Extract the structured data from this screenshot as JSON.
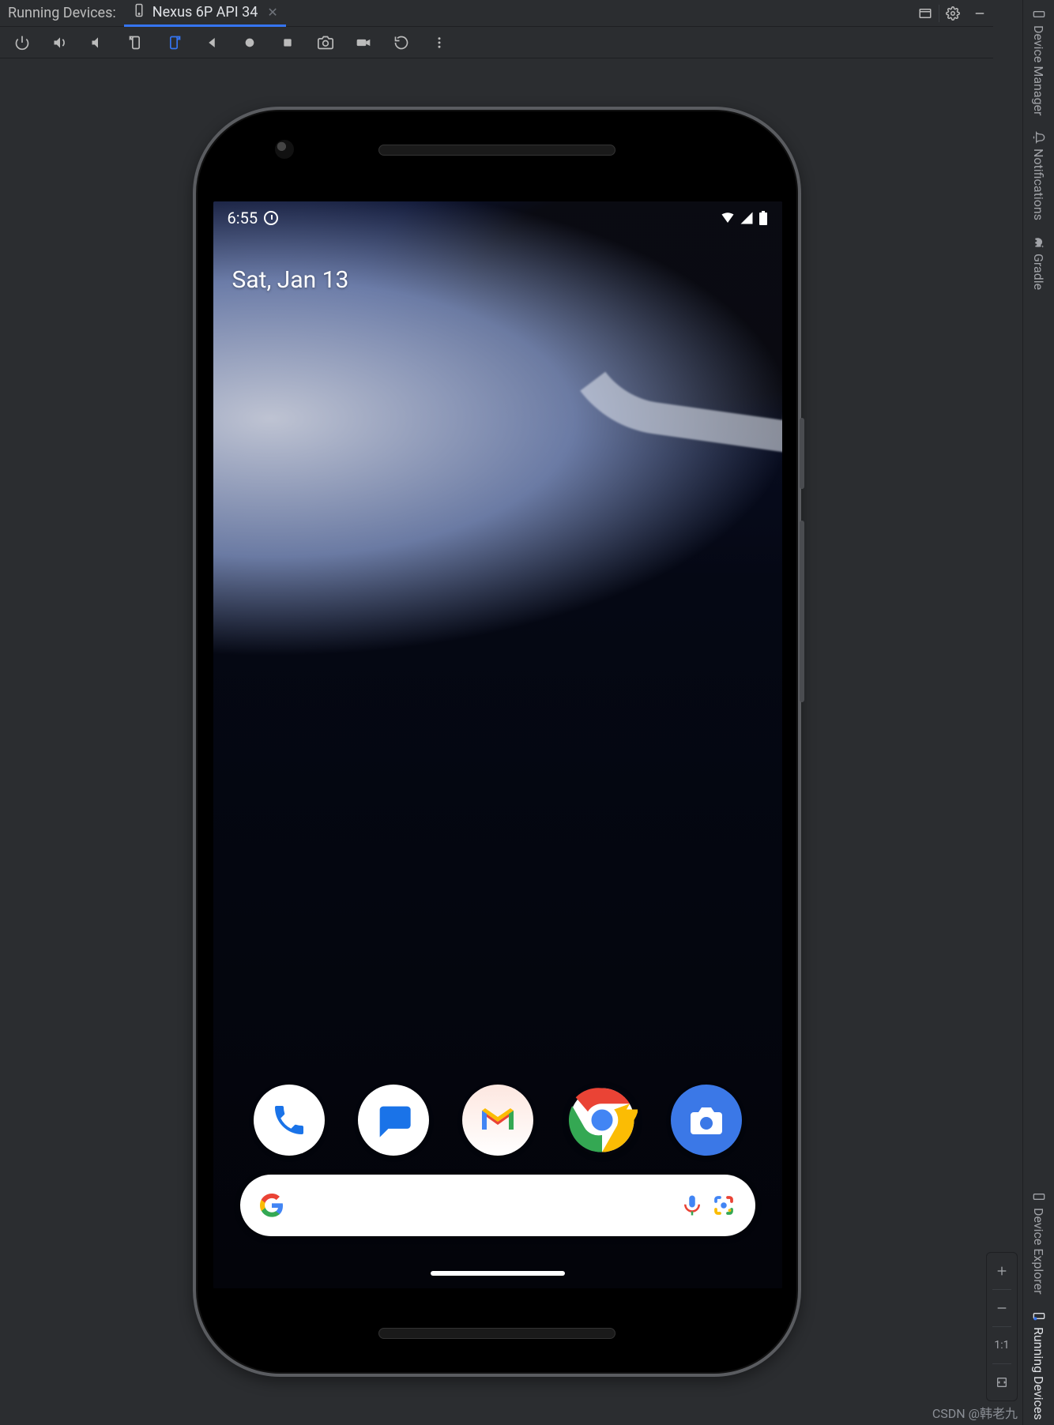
{
  "header": {
    "panel_label": "Running Devices:",
    "tab_name": "Nexus 6P API 34"
  },
  "toolbar": {
    "buttons": [
      {
        "id": "power",
        "name": "power-icon"
      },
      {
        "id": "volume_up",
        "name": "volume-up-icon"
      },
      {
        "id": "volume_down",
        "name": "volume-down-icon"
      },
      {
        "id": "rotate_left",
        "name": "rotate-left-icon"
      },
      {
        "id": "rotate_right",
        "name": "rotate-right-icon",
        "active": true
      },
      {
        "id": "back",
        "name": "back-icon"
      },
      {
        "id": "home",
        "name": "home-icon"
      },
      {
        "id": "overview",
        "name": "overview-icon"
      },
      {
        "id": "screenshot",
        "name": "screenshot-icon"
      },
      {
        "id": "record",
        "name": "screen-record-icon"
      },
      {
        "id": "snapshots",
        "name": "snapshot-icon"
      },
      {
        "id": "more",
        "name": "more-vertical-icon"
      }
    ]
  },
  "right_tabs": {
    "top": [
      {
        "id": "device_manager",
        "label": "Device Manager",
        "icon": "phone-icon"
      },
      {
        "id": "notifications",
        "label": "Notifications",
        "icon": "bell-icon"
      },
      {
        "id": "gradle",
        "label": "Gradle",
        "icon": "gradle-icon"
      }
    ],
    "bottom": [
      {
        "id": "device_explorer",
        "label": "Device Explorer",
        "icon": "phone-icon"
      },
      {
        "id": "running_devices",
        "label": "Running Devices",
        "icon": "phone-play-icon",
        "active": true
      }
    ]
  },
  "zoom": {
    "one_to_one": "1:1"
  },
  "phone": {
    "status": {
      "time": "6:55"
    },
    "date": "Sat, Jan 13",
    "dock": [
      {
        "id": "phone",
        "name": "phone-app-icon"
      },
      {
        "id": "messages",
        "name": "messages-app-icon"
      },
      {
        "id": "gmail",
        "name": "gmail-app-icon"
      },
      {
        "id": "chrome",
        "name": "chrome-app-icon"
      },
      {
        "id": "camera",
        "name": "camera-app-icon"
      }
    ]
  },
  "watermark": "CSDN @韩老九"
}
